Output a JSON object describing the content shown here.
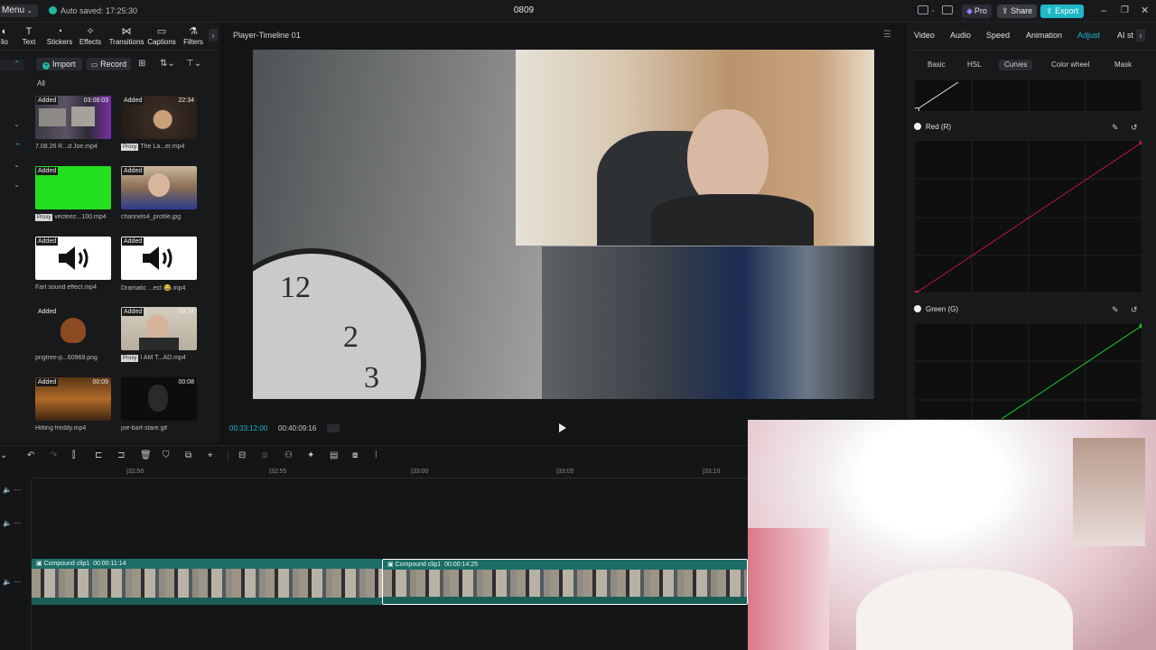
{
  "titlebar": {
    "menu_label": "Menu",
    "autosave_text": "Auto saved: 17:25:30",
    "project_title": "0809",
    "pro_label": "Pro",
    "share_label": "Share",
    "export_label": "Export"
  },
  "toolbar_tabs": [
    {
      "label": "lio",
      "icon": "media-icon"
    },
    {
      "label": "Text",
      "icon": "text-icon"
    },
    {
      "label": "Stickers",
      "icon": "sticker-icon"
    },
    {
      "label": "Effects",
      "icon": "effects-icon"
    },
    {
      "label": "Transitions",
      "icon": "transitions-icon"
    },
    {
      "label": "Captions",
      "icon": "captions-icon"
    },
    {
      "label": "Filters",
      "icon": "filters-icon"
    }
  ],
  "media_panel": {
    "import_label": "Import",
    "record_label": "Record",
    "all_label": "All",
    "items": [
      {
        "name": "7.08.26 R...d Joe.mp4",
        "added": "Added",
        "duration": "03:08:03",
        "proxy": ""
      },
      {
        "name": "The La...er.mp4",
        "added": "Added",
        "duration": "22:34",
        "proxy": "Proxy"
      },
      {
        "name": "vecteez...100.mp4",
        "added": "Added",
        "duration": "",
        "proxy": "Proxy"
      },
      {
        "name": "channels4_profile.jpg",
        "added": "Added",
        "duration": "",
        "proxy": ""
      },
      {
        "name": "Fart sound effect.mp4",
        "added": "Added",
        "duration": "",
        "proxy": ""
      },
      {
        "name": "Dramatic ...ect 😂.mp4",
        "added": "Added",
        "duration": "",
        "proxy": ""
      },
      {
        "name": "pngtree-p...60969.png",
        "added": "Added",
        "duration": "",
        "proxy": ""
      },
      {
        "name": "I AM T...AD.mp4",
        "added": "Added",
        "duration": "29:14",
        "proxy": "Proxy"
      },
      {
        "name": "Hitting freddy.mp4",
        "added": "Added",
        "duration": "00:09",
        "proxy": ""
      },
      {
        "name": "joe-bart-stare.gif",
        "added": "",
        "duration": "00:08",
        "proxy": ""
      }
    ]
  },
  "player": {
    "title": "Player-Timeline 01",
    "current_time": "00:33:12:00",
    "total_time": "00:40:09:16"
  },
  "right_panel": {
    "tabs": [
      "Video",
      "Audio",
      "Speed",
      "Animation",
      "Adjust",
      "AI st"
    ],
    "active_tab": "Adjust",
    "subtabs": [
      "Basic",
      "HSL",
      "Curves",
      "Color wheel",
      "Mask"
    ],
    "active_subtab": "Curves",
    "curves": {
      "red_label": "Red (R)",
      "green_label": "Green (G)"
    },
    "colors": {
      "red_curve": "#c0173a",
      "green_curve": "#18d12a",
      "accent": "#1fb8c8"
    }
  },
  "timeline": {
    "ruler": [
      "|32:50",
      "|32:55",
      "|33:00",
      "|33:05",
      "|33:10"
    ],
    "clips": [
      {
        "label": "Compound clip1",
        "duration": "00:00:11:14"
      },
      {
        "label": "Compound clip1",
        "duration": "00:00:14:25"
      }
    ]
  }
}
